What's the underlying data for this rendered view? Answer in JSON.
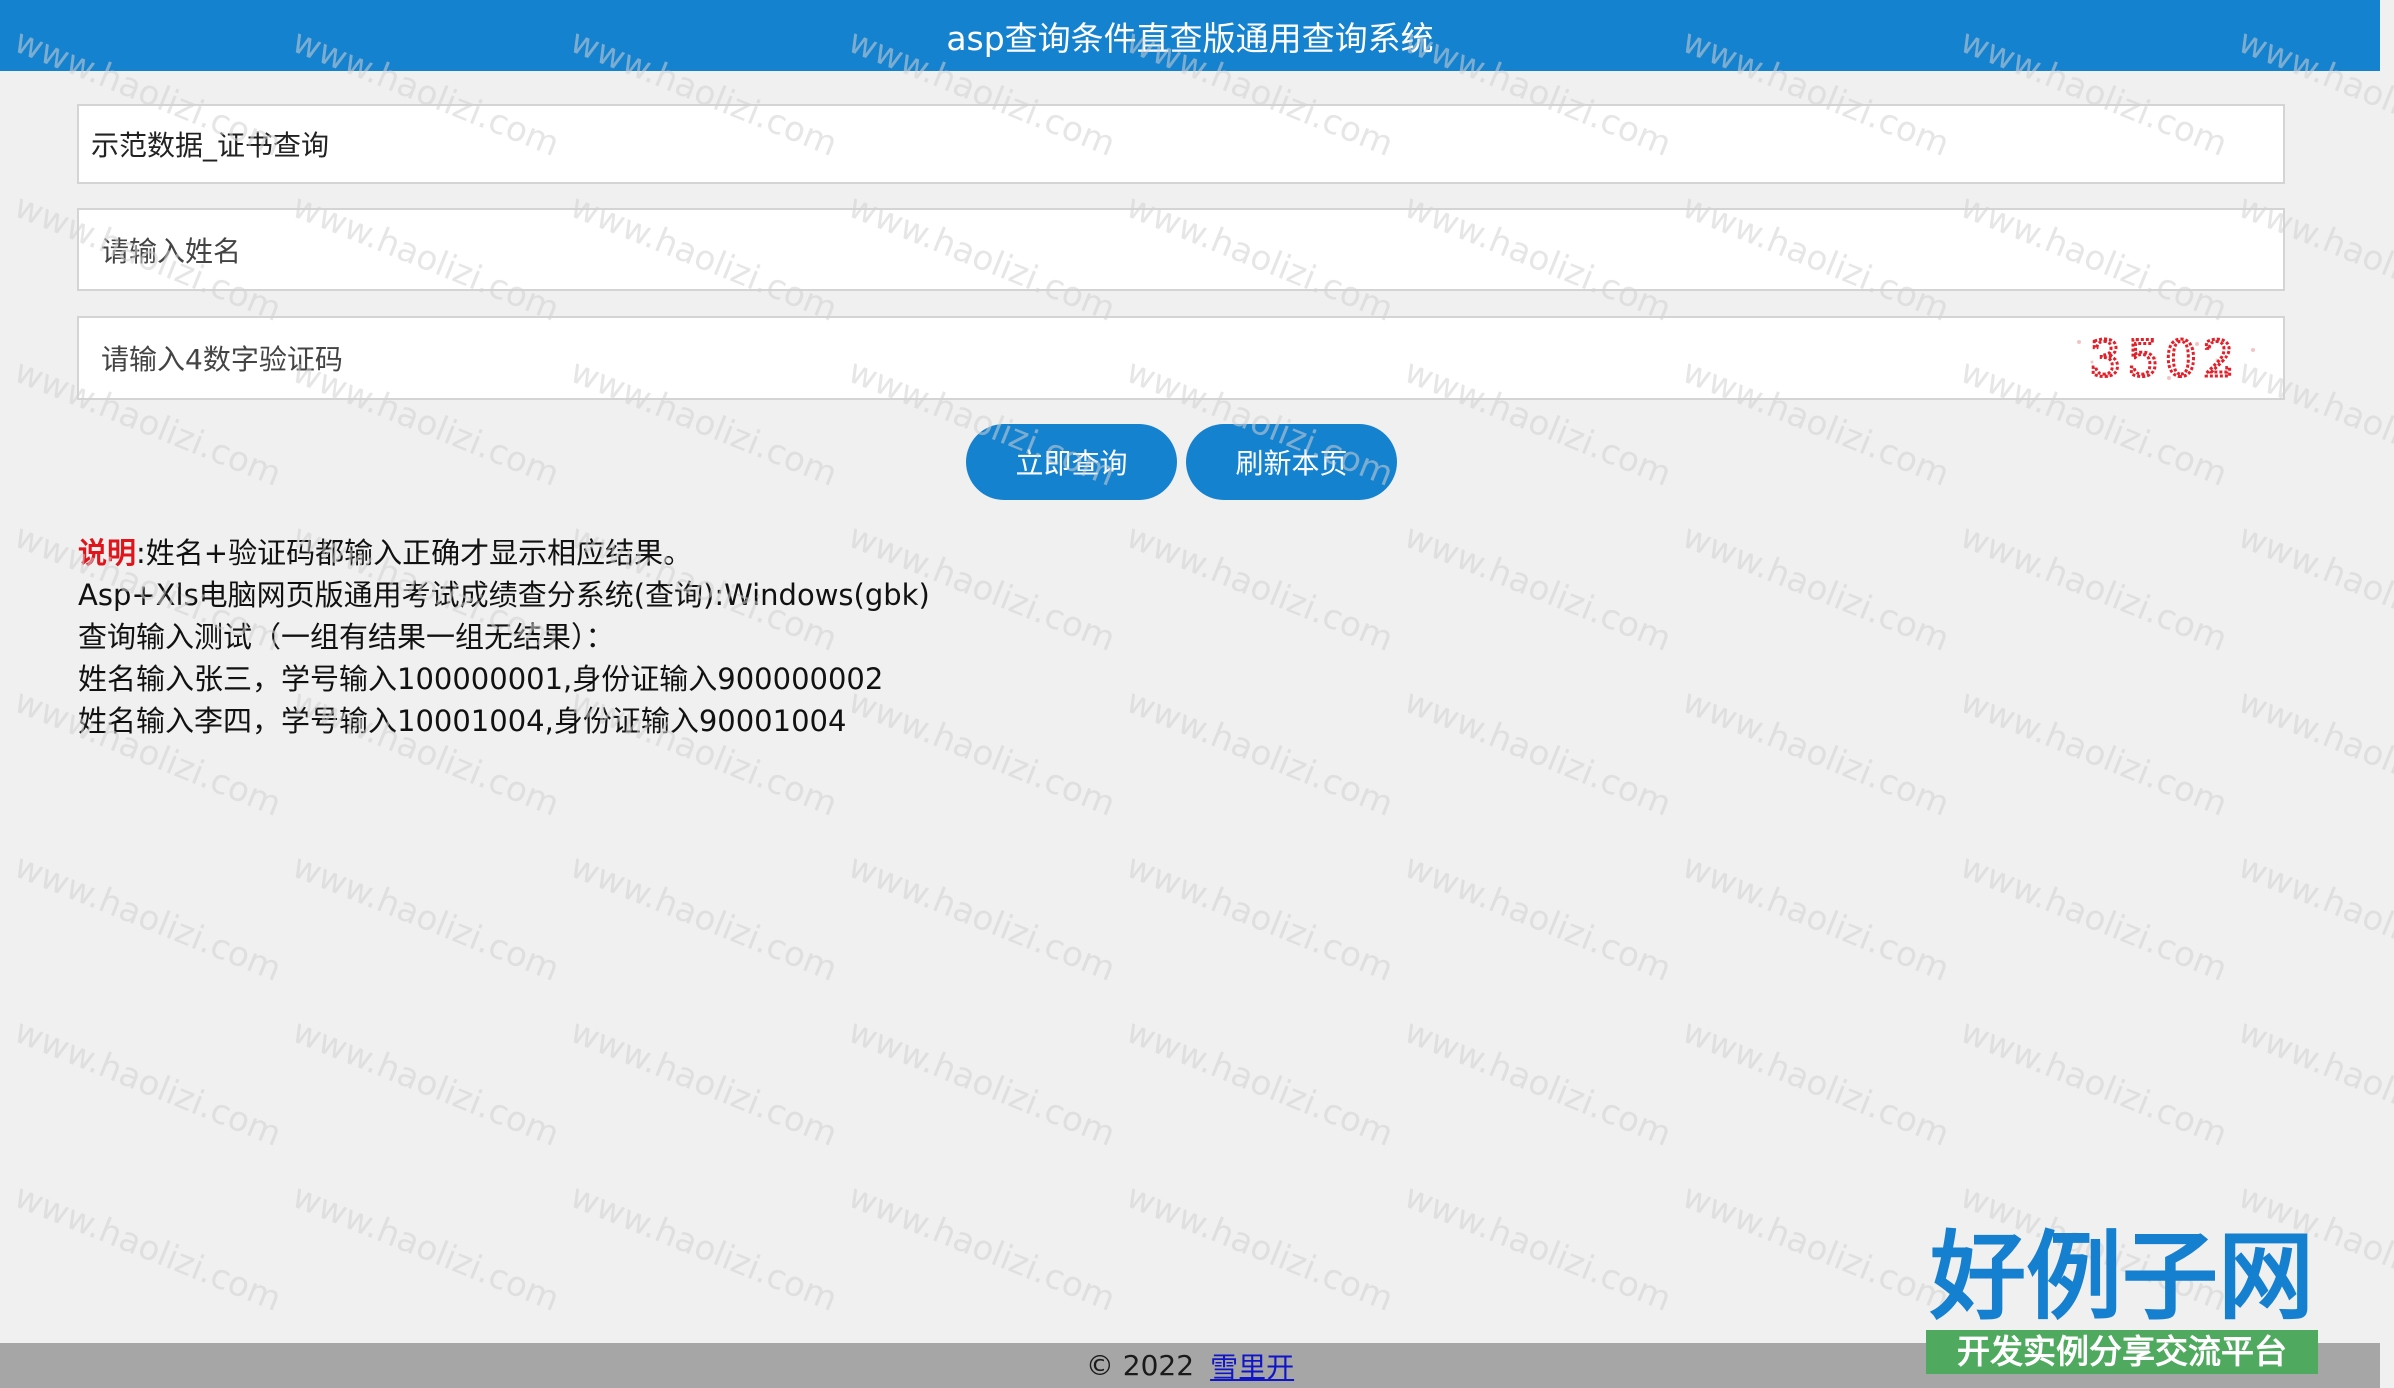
{
  "header": {
    "title": "asp查询条件直查版通用查询系统"
  },
  "form": {
    "dataset_value": "示范数据_证书查询",
    "name_placeholder": "请输入姓名",
    "code_placeholder": "请输入4数字验证码",
    "captcha_text": "3502"
  },
  "buttons": {
    "query_label": "立即查询",
    "refresh_label": "刷新本页"
  },
  "notes": {
    "label": "说明",
    "line1_rest": ":姓名+验证码都输入正确才显示相应结果。",
    "line2": "Asp+Xls电脑网页版通用考试成绩查分系统(查询):Windows(gbk)",
    "line3": "查询输入测试（一组有结果一组无结果）：",
    "line4": "姓名输入张三，学号输入100000001,身份证输入900000002",
    "line5": "姓名输入李四，学号输入10001004,身份证输入90001004"
  },
  "footer": {
    "copyright": "© 2022",
    "author_link": "雪里开"
  },
  "watermark": {
    "text": "www.haolizi.com"
  },
  "logo": {
    "main_text": "好例子网",
    "sub_text": "开发实例分享交流平台"
  },
  "colors": {
    "accent": "#1482cf",
    "note_label": "#e0141b",
    "footer_bg": "#a6a6a6",
    "link": "#1016c8"
  }
}
